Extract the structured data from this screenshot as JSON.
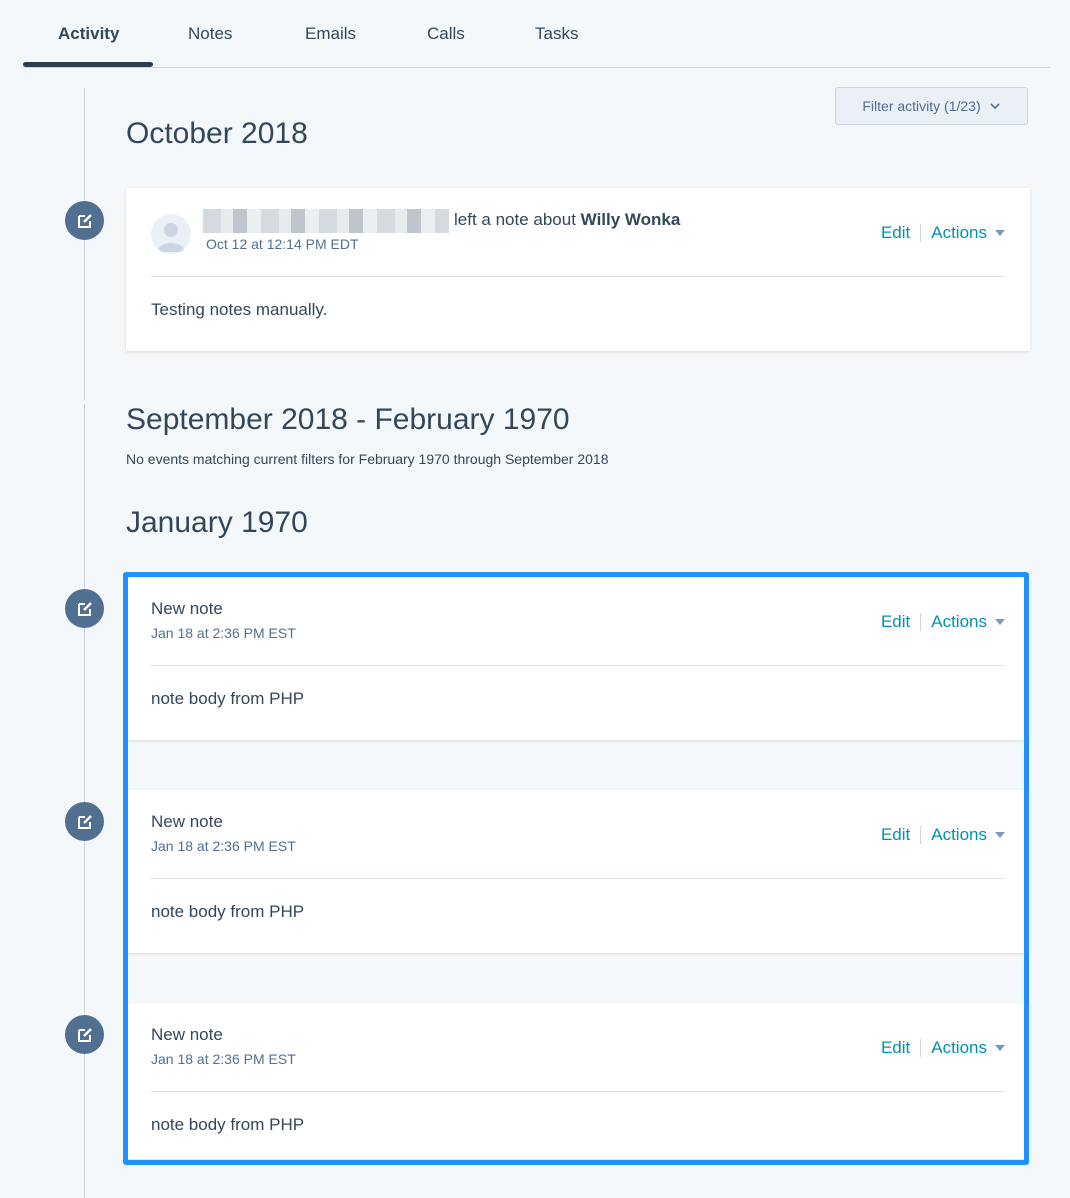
{
  "tabs": [
    {
      "label": "Activity",
      "active": true
    },
    {
      "label": "Notes"
    },
    {
      "label": "Emails"
    },
    {
      "label": "Calls"
    },
    {
      "label": "Tasks"
    }
  ],
  "filter": {
    "label": "Filter activity (1/23)"
  },
  "sections": {
    "october": {
      "heading": "October 2018"
    },
    "gap": {
      "heading": "September 2018 - February 1970",
      "message": "No events matching current filters for February 1970 through September 2018"
    },
    "january": {
      "heading": "January 1970"
    }
  },
  "cards": [
    {
      "title_prefix": "left a note about",
      "contact": "Willy Wonka",
      "timestamp": "Oct 12 at 12:14 PM EDT",
      "body": "Testing notes manually.",
      "edit_label": "Edit",
      "actions_label": "Actions"
    },
    {
      "title": "New note",
      "timestamp": "Jan 18 at 2:36 PM EST",
      "body": "note body from PHP",
      "edit_label": "Edit",
      "actions_label": "Actions"
    },
    {
      "title": "New note",
      "timestamp": "Jan 18 at 2:36 PM EST",
      "body": "note body from PHP",
      "edit_label": "Edit",
      "actions_label": "Actions"
    },
    {
      "title": "New note",
      "timestamp": "Jan 18 at 2:36 PM EST",
      "body": "note body from PHP",
      "edit_label": "Edit",
      "actions_label": "Actions"
    }
  ],
  "icons": {
    "timeline": "edit-note-icon",
    "avatar": "user-avatar-icon",
    "dropdown": "chevron-down-icon"
  },
  "colors": {
    "accent": "#0091ae",
    "highlight": "#1e90ff",
    "timeline_icon": "#516f90"
  }
}
